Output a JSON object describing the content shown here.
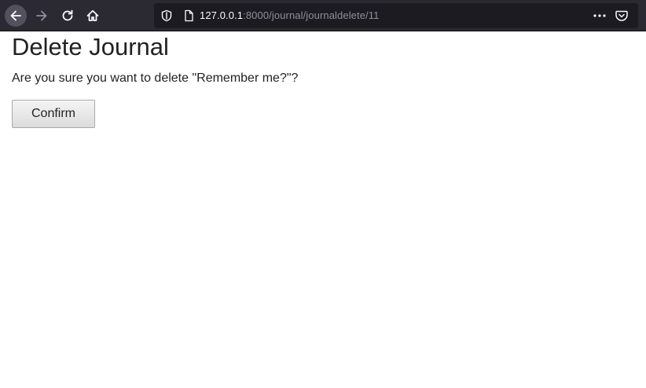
{
  "browser": {
    "url_host": "127.0.0.1",
    "url_path": ":8000/journal/journaldelete/11",
    "icons": {
      "back": "arrow-left-icon",
      "forward": "arrow-right-icon",
      "reload": "reload-icon",
      "home": "home-icon",
      "tracking": "shield-icon",
      "page": "page-icon",
      "more": "more-dots-icon",
      "pocket": "pocket-icon"
    }
  },
  "page": {
    "title": "Delete Journal",
    "message": "Are you sure you want to delete \"Remember me?\"?",
    "confirm_label": "Confirm"
  }
}
